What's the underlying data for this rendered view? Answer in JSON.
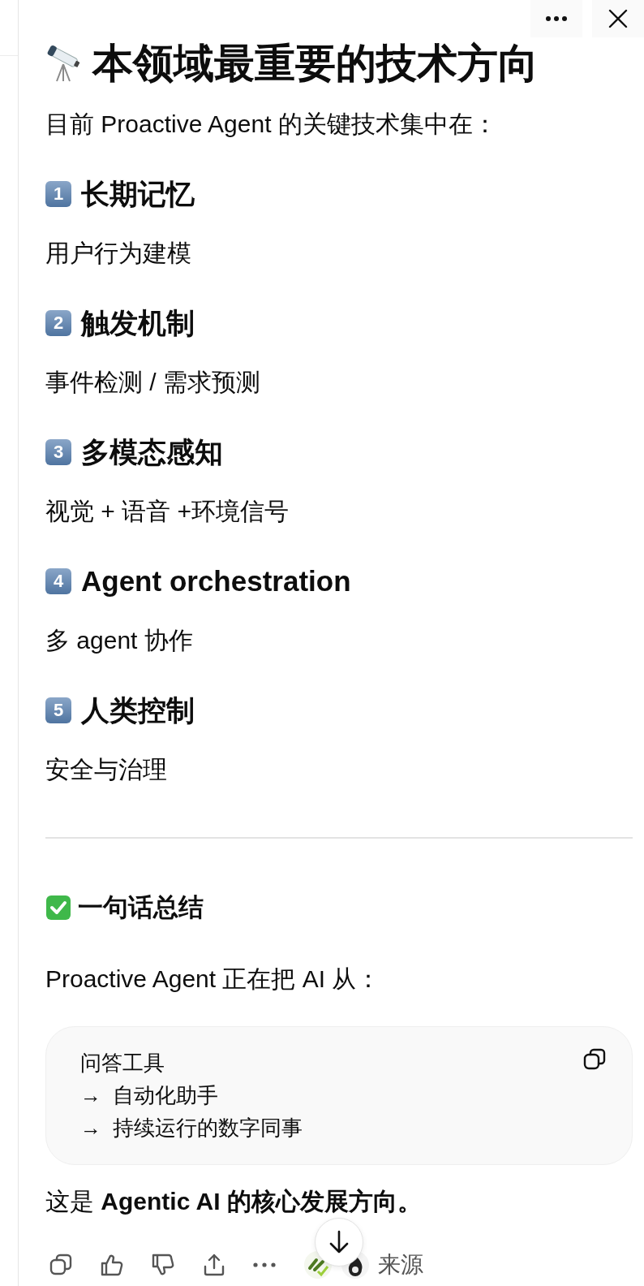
{
  "title": "本领域最重要的技术方向",
  "intro": "目前 Proactive Agent 的关键技术集中在：",
  "sections": [
    {
      "number": "1",
      "heading": "长期记忆",
      "body": "用户行为建模"
    },
    {
      "number": "2",
      "heading": "触发机制",
      "body": "事件检测 / 需求预测"
    },
    {
      "number": "3",
      "heading": "多模态感知",
      "body": "视觉 + 语音 +环境信号"
    },
    {
      "number": "4",
      "heading": "Agent orchestration",
      "body": "多 agent 协作"
    },
    {
      "number": "5",
      "heading": "人类控制",
      "body": "安全与治理"
    }
  ],
  "summary": {
    "heading": "一句话总结",
    "lead": "Proactive Agent 正在把 AI 从：",
    "code_lines": [
      "问答工具",
      "→  自动化助手",
      "→  持续运行的数字同事"
    ],
    "closing": "这是 **Agentic AI 的核心发展方向。**"
  },
  "toolbar": {
    "sources_label": "来源"
  }
}
